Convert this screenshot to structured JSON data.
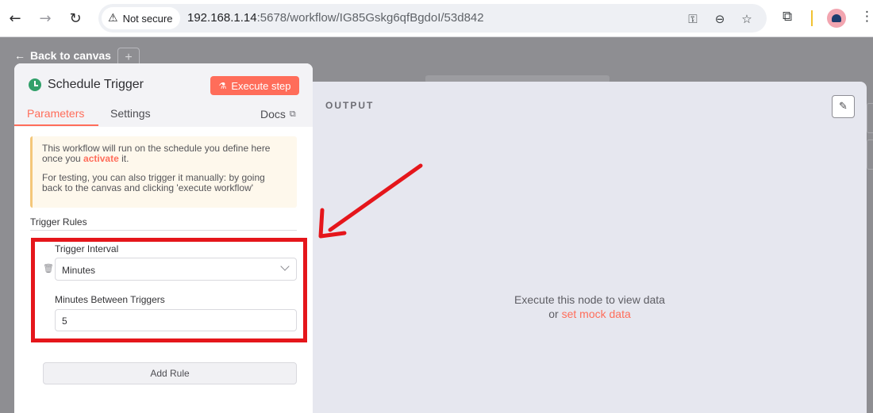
{
  "browser": {
    "security_label": "Not secure",
    "url_host": "192.168.1.14",
    "url_path": ":5678/workflow/IG85Gskg6qfBgdoI/53d842",
    "icons": [
      "back-arrow-icon",
      "forward-arrow-icon",
      "reload-icon",
      "key-icon",
      "zoom-icon",
      "star-icon",
      "extensions-icon",
      "profile-avatar",
      "menu-kebab-icon"
    ]
  },
  "canvas": {
    "back_label": "Back to canvas",
    "plus_label": "+"
  },
  "node": {
    "title": "Schedule Trigger",
    "execute_label": "Execute step",
    "tabs": [
      "Parameters",
      "Settings"
    ],
    "docs_label": "Docs",
    "notice_line1_before": "This workflow will run on the schedule you define here once you ",
    "notice_activate": "activate",
    "notice_line1_after": " it.",
    "notice_line2": "For testing, you can also trigger it manually: by going back to the canvas and clicking 'execute workflow'",
    "rules_heading": "Trigger Rules",
    "interval_label": "Trigger Interval",
    "interval_value": "Minutes",
    "minutes_label": "Minutes Between Triggers",
    "minutes_value": "5",
    "add_rule_label": "Add Rule"
  },
  "output": {
    "label": "OUTPUT",
    "empty_line1": "Execute this node to view data",
    "empty_or": "or ",
    "mock_link": "set mock data"
  },
  "colors": {
    "accent": "#ff6d5a",
    "annotation": "#e5161b",
    "trigger_icon": "#31a06a"
  }
}
